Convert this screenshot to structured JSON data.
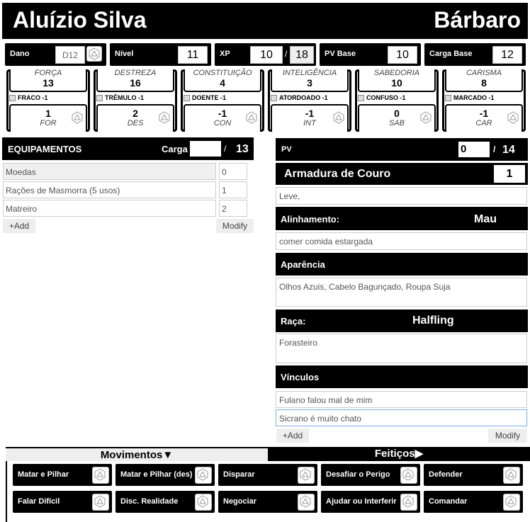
{
  "character": {
    "name": "Aluízio Silva",
    "class": "Bárbaro"
  },
  "stats": {
    "damage": {
      "label": "Dano",
      "value": "D12"
    },
    "level": {
      "label": "Nível",
      "value": "11"
    },
    "xp": {
      "label": "XP",
      "value": "10",
      "separator": "/",
      "max": "18"
    },
    "hp_base": {
      "label": "PV Base",
      "value": "10"
    },
    "load_base": {
      "label": "Carga Base",
      "value": "12"
    }
  },
  "attributes": [
    {
      "name": "FORÇA",
      "score": "13",
      "debility": "FRACO -1",
      "modifier": "1",
      "abbr": "FOR"
    },
    {
      "name": "DESTREZA",
      "score": "16",
      "debility": "TRÊMULO -1",
      "modifier": "2",
      "abbr": "DES"
    },
    {
      "name": "CONSTITUIÇÃO",
      "score": "4",
      "debility": "DOENTE -1",
      "modifier": "-1",
      "abbr": "CON"
    },
    {
      "name": "INTELIGÊNCIA",
      "score": "3",
      "debility": "ATORDOADO -1",
      "modifier": "-1",
      "abbr": "INT"
    },
    {
      "name": "SABEDORIA",
      "score": "10",
      "debility": "CONFUSO -1",
      "modifier": "0",
      "abbr": "SAB"
    },
    {
      "name": "CARISMA",
      "score": "8",
      "debility": "MARCADO -1",
      "modifier": "-1",
      "abbr": "CAR"
    }
  ],
  "equipment": {
    "title": "EQUIPAMENTOS",
    "load_label": "Carga",
    "load_value": "",
    "separator": "/",
    "load_max": "13",
    "items": [
      {
        "name": "Moedas",
        "qty": "0"
      },
      {
        "name": "Rações de Masmorra (5 usos)",
        "qty": "1"
      },
      {
        "name": "Matreiro",
        "qty": "2"
      }
    ],
    "add_label": "+Add",
    "modify_label": "Modify"
  },
  "hp": {
    "label": "PV",
    "value": "0",
    "separator": "/",
    "max": "14"
  },
  "armor": {
    "name": "Armadura de Couro",
    "value": "1",
    "notes": "Leve,"
  },
  "alignment": {
    "label": "Alinhamento:",
    "value": "Mau",
    "text": "comer comida estargada"
  },
  "appearance": {
    "label": "Aparência",
    "text": "Olhos Azuis, Cabelo Bagunçado, Roupa Suja"
  },
  "race": {
    "label": "Raça:",
    "value": "Halfling",
    "text": "Forasteiro"
  },
  "bonds": {
    "label": "Vínculos",
    "items": [
      "Fulano falou mal de mim",
      "Sicrano é muito chato"
    ],
    "add_label": "+Add",
    "modify_label": "Modify"
  },
  "tabs": {
    "moves": "Movimentos▼",
    "spells": "Feitiços▶"
  },
  "moves": [
    "Matar e Pilhar",
    "Matar e Pilhar (des)",
    "Disparar",
    "Desafiar o Perigo",
    "Defender",
    "Falar Difícil",
    "Disc. Realidade",
    "Negociar",
    "Ajudar ou Interferir",
    "Comandar"
  ],
  "icons": {
    "dice": "d20-dice-icon",
    "checkbox": "checkbox-icon"
  },
  "colors": {
    "primary": "#000000",
    "field_border": "#cccccc",
    "muted_text": "#555555"
  }
}
